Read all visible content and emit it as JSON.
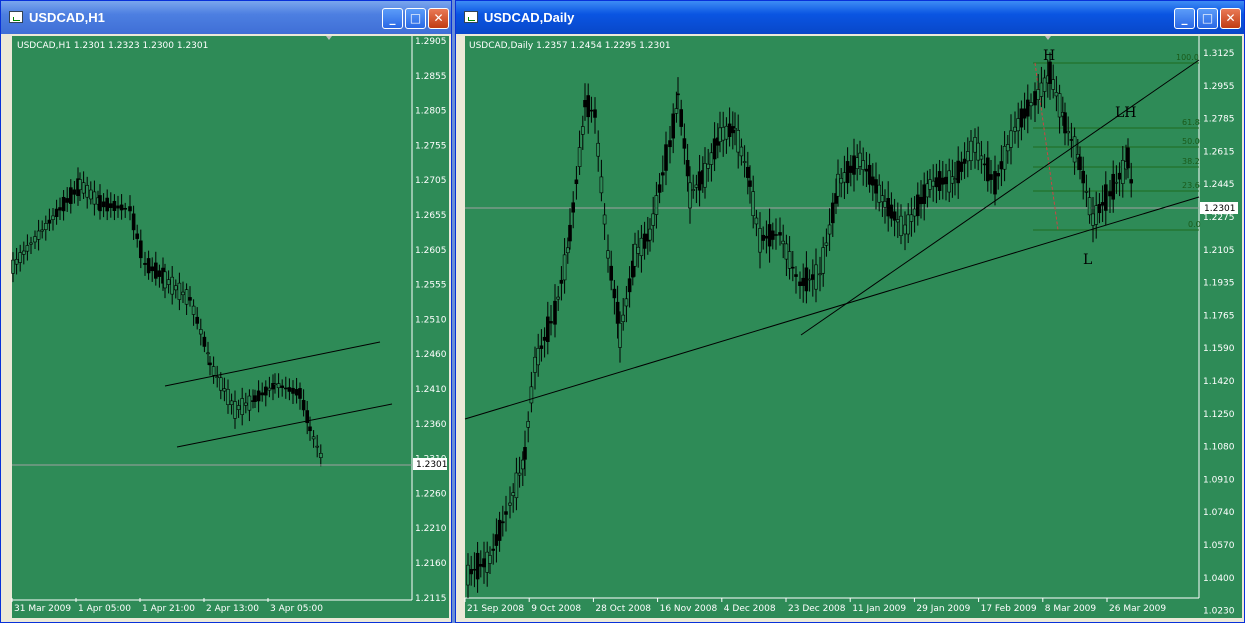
{
  "windows": [
    {
      "title": "USDCAD,H1",
      "info": "USDCAD,H1  1.2301 1.2323 1.2300 1.2301",
      "price_labels": [
        "1.2905",
        "1.2855",
        "1.2805",
        "1.2755",
        "1.2705",
        "1.2655",
        "1.2605",
        "1.2555",
        "1.2510",
        "1.2460",
        "1.2410",
        "1.2360",
        "1.2310",
        "1.2260",
        "1.2210",
        "1.2160",
        "1.2115"
      ],
      "current_price": "1.2301",
      "date_labels": [
        "31 Mar 2009",
        "1 Apr 05:00",
        "1 Apr 21:00",
        "2 Apr 13:00",
        "3 Apr 05:00"
      ],
      "buttons": {
        "minimize": "_",
        "maximize": "□",
        "close": "✕"
      }
    },
    {
      "title": "USDCAD,Daily",
      "info": "USDCAD,Daily  1.2357 1.2454 1.2295 1.2301",
      "price_labels": [
        "1.3125",
        "1.2955",
        "1.2785",
        "1.2615",
        "1.2445",
        "1.2275",
        "1.2105",
        "1.1935",
        "1.1765",
        "1.1590",
        "1.1420",
        "1.1250",
        "1.1080",
        "1.0910",
        "1.0740",
        "1.0570",
        "1.0400",
        "1.0230"
      ],
      "current_price": "1.2301",
      "date_labels": [
        "21 Sep 2008",
        "9 Oct 2008",
        "28 Oct 2008",
        "16 Nov 2008",
        "4 Dec 2008",
        "23 Dec 2008",
        "11 Jan 2009",
        "29 Jan 2009",
        "17 Feb 2009",
        "8 Mar 2009",
        "26 Mar 2009"
      ],
      "annotations": {
        "head": "H",
        "lower_high": "LH",
        "low": "L"
      },
      "fib_levels": [
        "100.0",
        "61.8",
        "50.0",
        "38.2",
        "23.6",
        "0.0"
      ],
      "buttons": {
        "minimize": "_",
        "maximize": "□",
        "close": "✕"
      }
    }
  ],
  "colors": {
    "chart_bg": "#2e8b57",
    "titlebar_active": "#0a55e2",
    "titlebar_inactive": "#4d7fe1"
  }
}
